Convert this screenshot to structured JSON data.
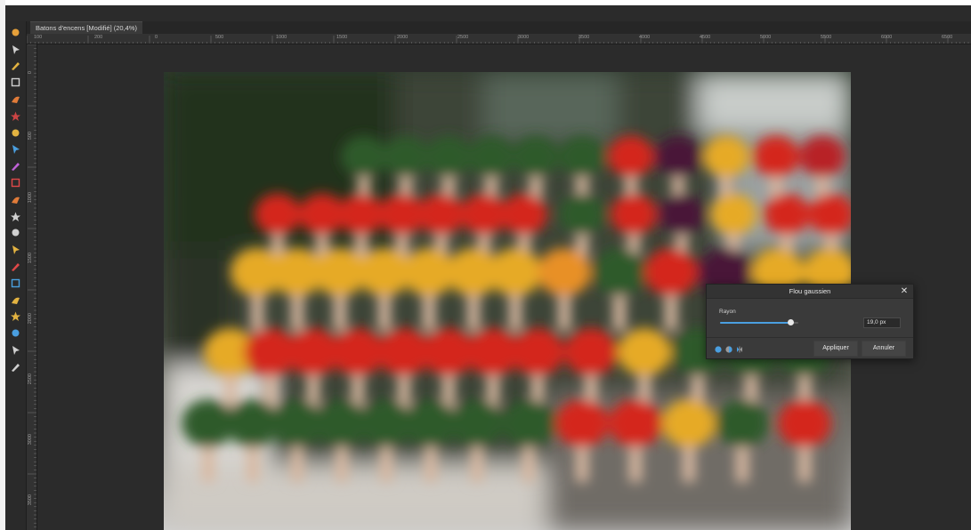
{
  "tab": {
    "title": "Batons d'encens [Modifié] (20,4%)"
  },
  "ruler": {
    "h_numbers": [
      "100",
      "200",
      "0",
      "500",
      "1000",
      "1500",
      "2000",
      "2500",
      "3000",
      "3500",
      "4000",
      "4500",
      "5000",
      "5500",
      "6000",
      "6500"
    ],
    "v_numbers": [
      "0",
      "500",
      "1000",
      "1500",
      "2000",
      "2500",
      "3000",
      "3500"
    ]
  },
  "toolbar": {
    "tools": [
      "hand-tool-icon",
      "move-tool-icon",
      "brush-tool-icon",
      "crop-tool-icon",
      "eyedropper-tool-icon",
      "selection-brush-icon",
      "lasso-tool-icon",
      "flood-fill-icon",
      "color-wheel-icon",
      "paint-brush-icon",
      "pixel-brush-icon",
      "eraser-icon",
      "clone-tool-icon",
      "dodge-tool-icon",
      "healing-brush-icon",
      "blur-tool-icon",
      "smudge-tool-icon",
      "sponge-tool-icon",
      "shape-tool-icon",
      "text-tool-icon",
      "zoom-tool-icon"
    ]
  },
  "dialog": {
    "title": "Flou gaussien",
    "close_label": "✕",
    "radius_label": "Rayon",
    "radius_value": "19,0 px",
    "radius_fraction": 0.9,
    "apply_label": "Appliquer",
    "cancel_label": "Annuler",
    "accent": "#4a9fe0"
  }
}
